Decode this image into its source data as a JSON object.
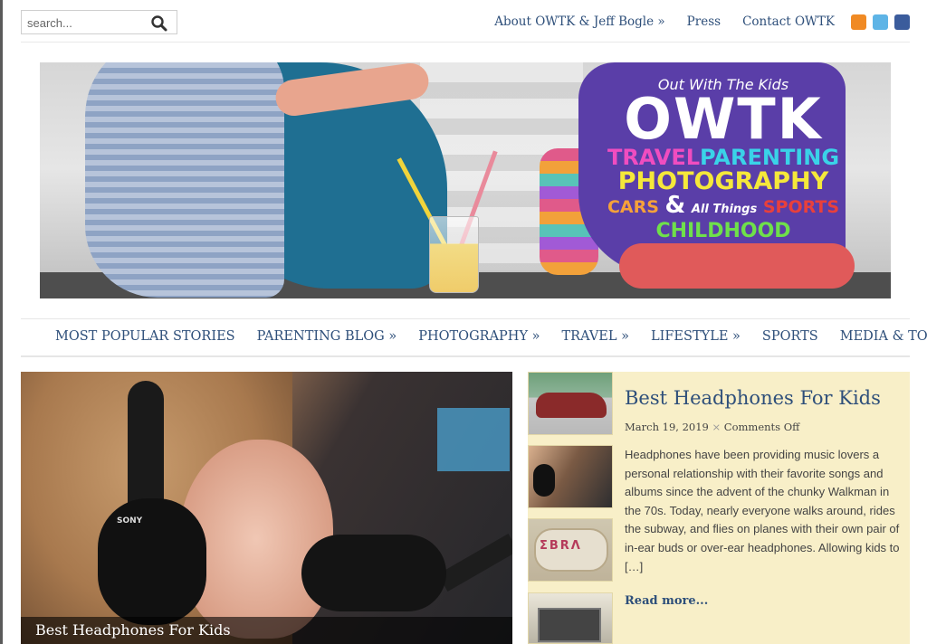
{
  "search": {
    "placeholder": "search..."
  },
  "top_links": [
    "About  OWTK  &  Jeff  Bogle  »",
    "Press",
    "Contact  OWTK"
  ],
  "social_icons": [
    "rss-icon",
    "twitter-icon",
    "facebook-icon"
  ],
  "banner": {
    "logo_tagline": "Out With The Kids",
    "logo_title": "OWTK",
    "logo_line1_a": "TRAVEL",
    "logo_line1_b": "PARENTING",
    "logo_line2": "PHOTOGRAPHY",
    "logo_line3_a": "CARS",
    "logo_line3_amp": "&",
    "logo_line3_b": "All Things",
    "logo_line3_c": "SPORTS",
    "logo_line3_d": "CHILDHOOD"
  },
  "nav": [
    "MOST POPULAR STORIES",
    "PARENTING BLOG »",
    "PHOTOGRAPHY »",
    "TRAVEL »",
    "LIFESTYLE »",
    "SPORTS",
    "MEDIA & TOYS »"
  ],
  "feature": {
    "caption": "Best Headphones For Kids",
    "brand_text": "SONY"
  },
  "post": {
    "title": "Best Headphones For Kids",
    "date": "March 19, 2019",
    "separator": "×",
    "comments": "Comments Off",
    "excerpt": "Headphones have been providing music lovers a personal relationship with their favorite songs and albums since the advent of the chunky Walkman in the 70s. Today, nearly everyone walks around, rides the subway, and flies on planes with their own pair of in-ear buds or over-ear headphones. Allowing kids to […]",
    "read_more": "Read more..."
  },
  "thumbnails": {
    "pillow_text": "ΣBRΛ"
  },
  "colors": {
    "link": "#2e4f7a",
    "panel_bg": "#f8efc8",
    "rss": "#f08a24",
    "twitter": "#5eb4e6",
    "facebook": "#3b5c9c"
  }
}
